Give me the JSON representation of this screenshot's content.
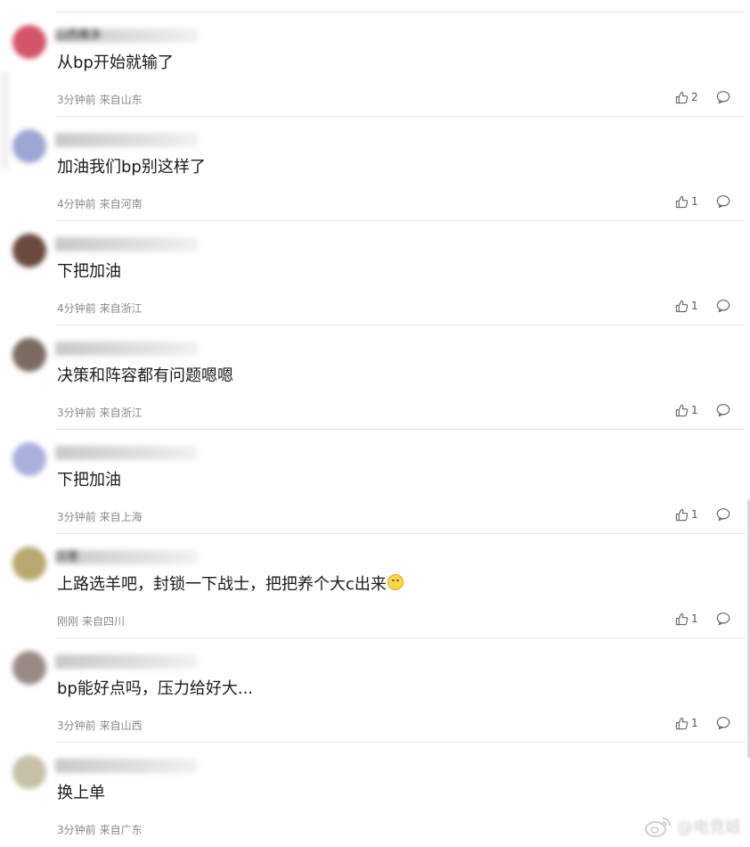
{
  "comments": [
    {
      "username": "山西雁多",
      "avatar_color": "#d4556b",
      "text": "从bp开始就输了",
      "time": "3分钟前",
      "location": "来自山东",
      "likes": "2"
    },
    {
      "username": "",
      "avatar_color": "#9ea6d4",
      "text": "加油我们bp别这样了",
      "time": "4分钟前",
      "location": "来自河南",
      "likes": "1"
    },
    {
      "username": "",
      "avatar_color": "#6b4a3e",
      "text": "下把加油",
      "time": "4分钟前",
      "location": "来自浙江",
      "likes": "1"
    },
    {
      "username": "",
      "avatar_color": "#7a6a62",
      "text": "决策和阵容都有问题嗯嗯",
      "time": "3分钟前",
      "location": "来自浙江",
      "likes": "1"
    },
    {
      "username": "",
      "avatar_color": "#aab0dc",
      "text": "下把加油",
      "time": "3分钟前",
      "location": "来自上海",
      "likes": "1"
    },
    {
      "username": "汉堡",
      "avatar_color": "#b8a76e",
      "text": "上路选羊吧，封锁一下战士，把把养个大c出来",
      "has_emoji": true,
      "emoji_icon": "sad-face-emoji",
      "time": "刚刚",
      "location": "来自四川",
      "likes": "1"
    },
    {
      "username": "",
      "avatar_color": "#9a8a86",
      "text": "bp能好点吗，压力给好大...",
      "time": "3分钟前",
      "location": "来自山西",
      "likes": "1"
    },
    {
      "username": "",
      "avatar_color": "#c6c1a6",
      "text": "换上单",
      "time": "3分钟前",
      "location": "来自广东",
      "likes": ""
    }
  ],
  "icons": {
    "like": "thumbs-up-icon",
    "reply": "comment-bubble-icon",
    "watermark": "weibo-logo-icon"
  },
  "colors": {
    "text": "#1a1a1a",
    "meta": "#8a8a8a",
    "divider": "#e6e6e6",
    "icon": "#666666"
  },
  "watermark": {
    "text": "@电竞姬"
  }
}
